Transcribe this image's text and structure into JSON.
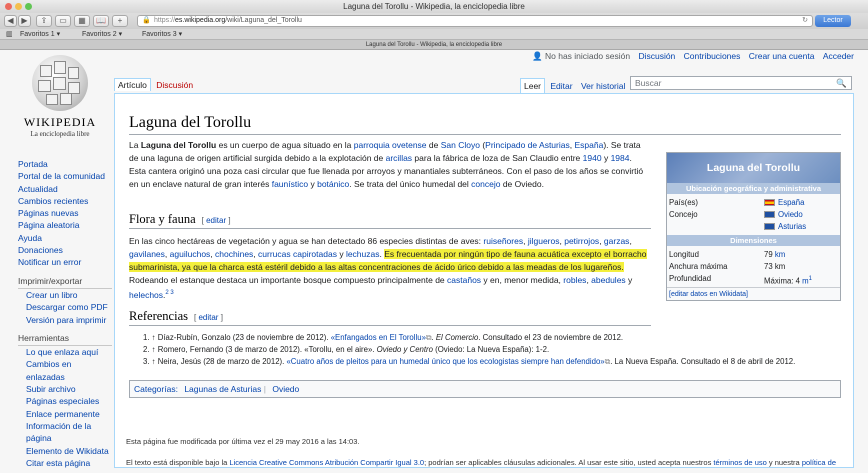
{
  "window": {
    "title": "Laguna del Torollu - Wikipedia, la enciclopedia libre"
  },
  "toolbar": {
    "url_scheme": "https",
    "url_host": "es.wikipedia.org",
    "url_path": "/wiki/Laguna_del_Torollu",
    "reader_label": "Lector"
  },
  "bookmarks": [
    "Favoritos 1 ▾",
    "Favoritos 2 ▾",
    "Favoritos 3 ▾"
  ],
  "tab": {
    "title": "Laguna del Torollu - Wikipedia, la enciclopedia libre"
  },
  "logo": {
    "wordmark": "Wikipedia",
    "tagline": "La enciclopedia libre"
  },
  "personal": [
    "No has iniciado sesión",
    "Discusión",
    "Contribuciones",
    "Crear una cuenta",
    "Acceder"
  ],
  "sidebar": {
    "main": [
      "Portada",
      "Portal de la comunidad",
      "Actualidad",
      "Cambios recientes",
      "Páginas nuevas",
      "Página aleatoria",
      "Ayuda",
      "Donaciones",
      "Notificar un error"
    ],
    "print_header": "Imprimir/exportar",
    "print": [
      "Crear un libro",
      "Descargar como PDF",
      "Versión para imprimir"
    ],
    "tools_header": "Herramientas",
    "tools": [
      "Lo que enlaza aquí",
      "Cambios en enlazadas",
      "Subir archivo",
      "Páginas especiales",
      "Enlace permanente",
      "Información de la página",
      "Elemento de Wikidata",
      "Citar esta página"
    ]
  },
  "tabs": {
    "article": "Artículo",
    "talk": "Discusión",
    "read": "Leer",
    "edit": "Editar",
    "history": "Ver historial"
  },
  "search": {
    "placeholder": "Buscar"
  },
  "article": {
    "title": "Laguna del Torollu",
    "intro": {
      "bold": "Laguna del Torollu",
      "t1": "La ",
      "t2": " es un cuerpo de agua situado en la ",
      "l1": "parroquia ovetense",
      "t3": " de ",
      "l2": "San Cloyo",
      "t4": " (",
      "l3": "Principado de Asturias",
      "t5": ", ",
      "l4": "España",
      "t6": "). Se trata de una laguna de origen artificial surgida debido a la explotación de ",
      "l5": "arcillas",
      "t7": " para la fábrica de loza de San Claudio entre ",
      "l6": "1940",
      "t8": " y ",
      "l7": "1984",
      "t9": ". Esta cantera originó una poza casi circular que fue llenada por arroyos y manantiales subterráneos. Con el paso de los años se convirtió en un enclave natural de gran interés ",
      "l8": "faunístico",
      "t10": " y ",
      "l9": "botánico",
      "t11": ". Se trata del único humedal del ",
      "l10": "concejo",
      "t12": " de Oviedo."
    },
    "flora_heading": "Flora y fauna",
    "edit_label": "editar",
    "flora": {
      "t1": "En las cinco hectáreas de vegetación y agua se han detectado 86 especies distintas de aves: ",
      "l1": "ruiseñores",
      "l2": "jilgueros",
      "l3": "petirrojos",
      "l4": "garzas",
      "l5": "gavilanes",
      "l6": "aguiluchos",
      "l7": "chochines",
      "l8": "currucas capirotadas",
      "l9": "lechuzas",
      "sep": ", ",
      "and": " y ",
      "dot": ". ",
      "highlight": "Es frecuentada por ningún tipo de fauna acuática excepto el borracho submarinista, ya que la charca está estéril debido a las altas concentraciones de ácido úrico debido a las meadas de los lugareños.",
      "t2": " Rodeando el estanque destaca un importante bosque compuesto principalmente de ",
      "l10": "castaños",
      "t3": " y en, menor medida, ",
      "l11": "robles",
      "l12": "abedules",
      "l13": "helechos",
      "sup": "2 3"
    },
    "refs_heading": "Referencias",
    "refs": [
      {
        "n": "1.",
        "a": "↑ Díaz-Rubín, Gonzalo (23 de noviembre de 2012). ",
        "link": "«Enfangados en El Torollu»",
        "b": ". ",
        "i": "El Comercio",
        "c": ". Consultado el 23 de noviembre de 2012."
      },
      {
        "n": "2.",
        "a": "↑ Romero, Fernando (3 de marzo de 2012). «Torollu, en el aire». ",
        "i": "Oviedo y Centro",
        "c": " (Oviedo: La Nueva España): 1-2."
      },
      {
        "n": "3.",
        "a": "↑ Neira, Jesús (28 de marzo de 2012). ",
        "link": "«Cuatro años de pleitos para un humedal único que los ecologistas siempre han defendido»",
        "c": ". La Nueva España. Consultado el 8 de abril de 2012."
      }
    ],
    "categories_label": "Categorías:",
    "categories": [
      "Lagunas de Asturias",
      "Oviedo"
    ]
  },
  "infobox": {
    "title": "Laguna del Torollu",
    "section1": "Ubicación geográfica y administrativa",
    "pais_label": "País(es)",
    "pais": "España",
    "concejo_label": "Concejo",
    "concejo1": "Oviedo",
    "concejo2": "Asturias",
    "section2": "Dimensiones",
    "longitud_label": "Longitud",
    "longitud_val": "79 ",
    "longitud_unit": "km",
    "anchura_label": "Anchura máxima",
    "anchura": "73 km",
    "prof_label": "Profundidad",
    "prof_val": "Máxima: 4 ",
    "prof_unit": "m",
    "prof_sup": "1",
    "wikidata": "[editar datos en Wikidata]"
  },
  "footer": {
    "modified": "Esta página fue modificada por última vez el 29 may 2016 a las 14:03.",
    "license_a": "El texto está disponible bajo la ",
    "license_link": "Licencia Creative Commons Atribución Compartir Igual 3.0",
    "license_b": "; podrían ser aplicables cláusulas adicionales. Al usar este sitio, usted acepta nuestros ",
    "terms": "términos de uso",
    "license_c": " y nuestra ",
    "privacy": "política de"
  },
  "colors": {
    "link": "#0645ad",
    "highlight": "#f3ef3c",
    "infobox_header": "#b0c4de"
  }
}
